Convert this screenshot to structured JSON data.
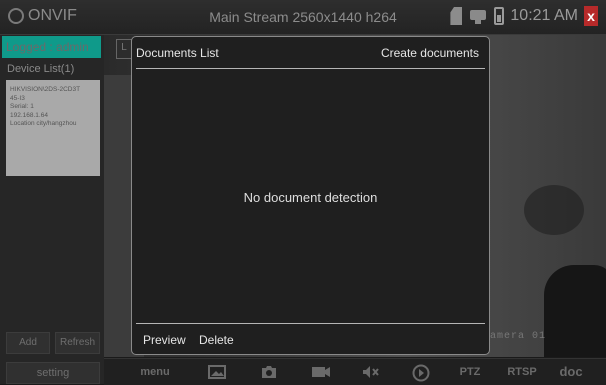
{
  "header": {
    "app_name": "ONVIF",
    "stream_title": "Main Stream 2560x1440 h264",
    "time": "10:21 AM",
    "close_glyph": "x"
  },
  "sidebar": {
    "logged": "Logged : admin",
    "device_list": "Device List(1)",
    "device": {
      "lines": [
        "HIKVISION\\2DS-2CD3T",
        "45-I3",
        "Serial: 1",
        "192.168.1.64",
        "Location city/hangzhou"
      ]
    },
    "add": "Add",
    "refresh": "Refresh",
    "setting": "setting"
  },
  "video": {
    "tab_stub": "L",
    "osd": "amera 01"
  },
  "dialog": {
    "title": "Documents List",
    "create": "Create documents",
    "empty": "No document detection",
    "preview": "Preview",
    "delete": "Delete"
  },
  "toolbar": {
    "menu": "menu",
    "ptz": "PTZ",
    "rtsp": "RTSP",
    "doc": "doc",
    "icons": [
      "image-icon",
      "camera-icon",
      "video-record-icon",
      "mute-icon",
      "play-icon"
    ]
  },
  "colors": {
    "logged_bg": "#0f9a8a",
    "close_bg": "#b72a2a",
    "dialog_bg": "#1f1f1f"
  }
}
